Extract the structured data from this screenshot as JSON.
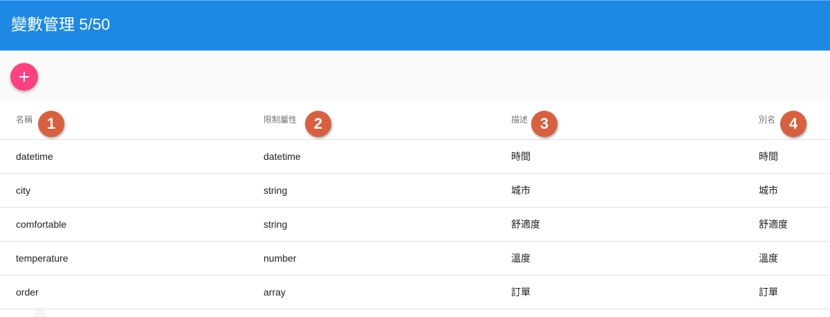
{
  "header": {
    "title": "變數管理 5/50"
  },
  "toolbar": {
    "add_icon": "plus-icon",
    "fab_color": "#ff4081"
  },
  "colors": {
    "header_bg": "#1e88e5",
    "marker_bg": "#d9603f"
  },
  "table": {
    "columns": [
      "名稱",
      "限制屬性",
      "描述",
      "別名"
    ],
    "markers": [
      "1",
      "2",
      "3",
      "4"
    ],
    "rows": [
      [
        "datetime",
        "datetime",
        "時間",
        "時間"
      ],
      [
        "city",
        "string",
        "城市",
        "城市"
      ],
      [
        "comfortable",
        "string",
        "舒適度",
        "舒適度"
      ],
      [
        "temperature",
        "number",
        "溫度",
        "溫度"
      ],
      [
        "order",
        "array",
        "訂單",
        "訂單"
      ]
    ]
  }
}
